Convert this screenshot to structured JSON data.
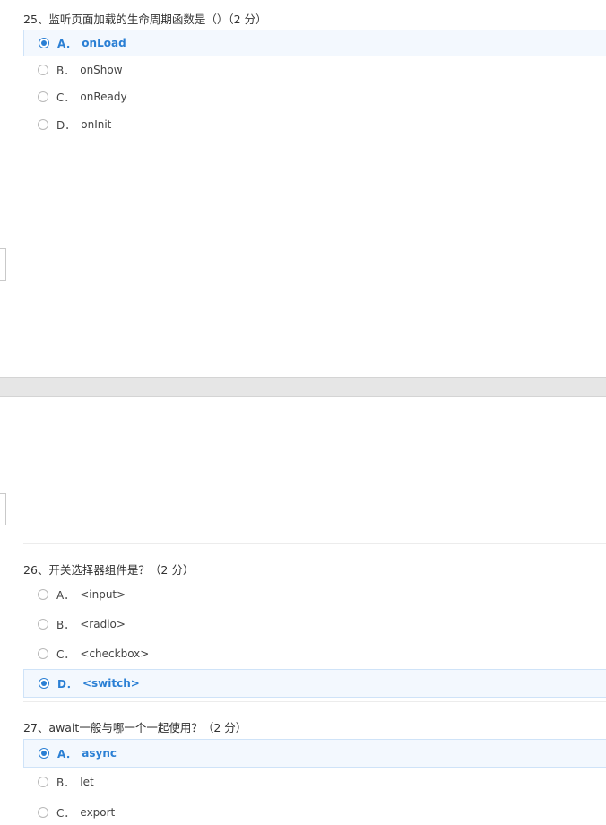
{
  "q25": {
    "title": "25、监听页面加载的生命周期函数是（）（2 分）",
    "options": [
      {
        "letter": "A．",
        "text": "onLoad",
        "selected": true
      },
      {
        "letter": "B．",
        "text": "onShow",
        "selected": false
      },
      {
        "letter": "C．",
        "text": "onReady",
        "selected": false
      },
      {
        "letter": "D．",
        "text": "onInit",
        "selected": false
      }
    ]
  },
  "q26": {
    "title": "26、开关选择器组件是？（2 分）",
    "options": [
      {
        "letter": "A．",
        "text": "<input>",
        "selected": false
      },
      {
        "letter": "B．",
        "text": "<radio>",
        "selected": false
      },
      {
        "letter": "C．",
        "text": "<checkbox>",
        "selected": false
      },
      {
        "letter": "D．",
        "text": "<switch>",
        "selected": true
      }
    ]
  },
  "q27": {
    "title": "27、await一般与哪一个一起使用？（2 分）",
    "options": [
      {
        "letter": "A．",
        "text": "async",
        "selected": true
      },
      {
        "letter": "B．",
        "text": "let",
        "selected": false
      },
      {
        "letter": "C．",
        "text": "export",
        "selected": false
      }
    ]
  },
  "colors": {
    "accent": "#2a7fd4",
    "selected_bg": "#f3f8fe",
    "separator": "#e6e6e6"
  }
}
